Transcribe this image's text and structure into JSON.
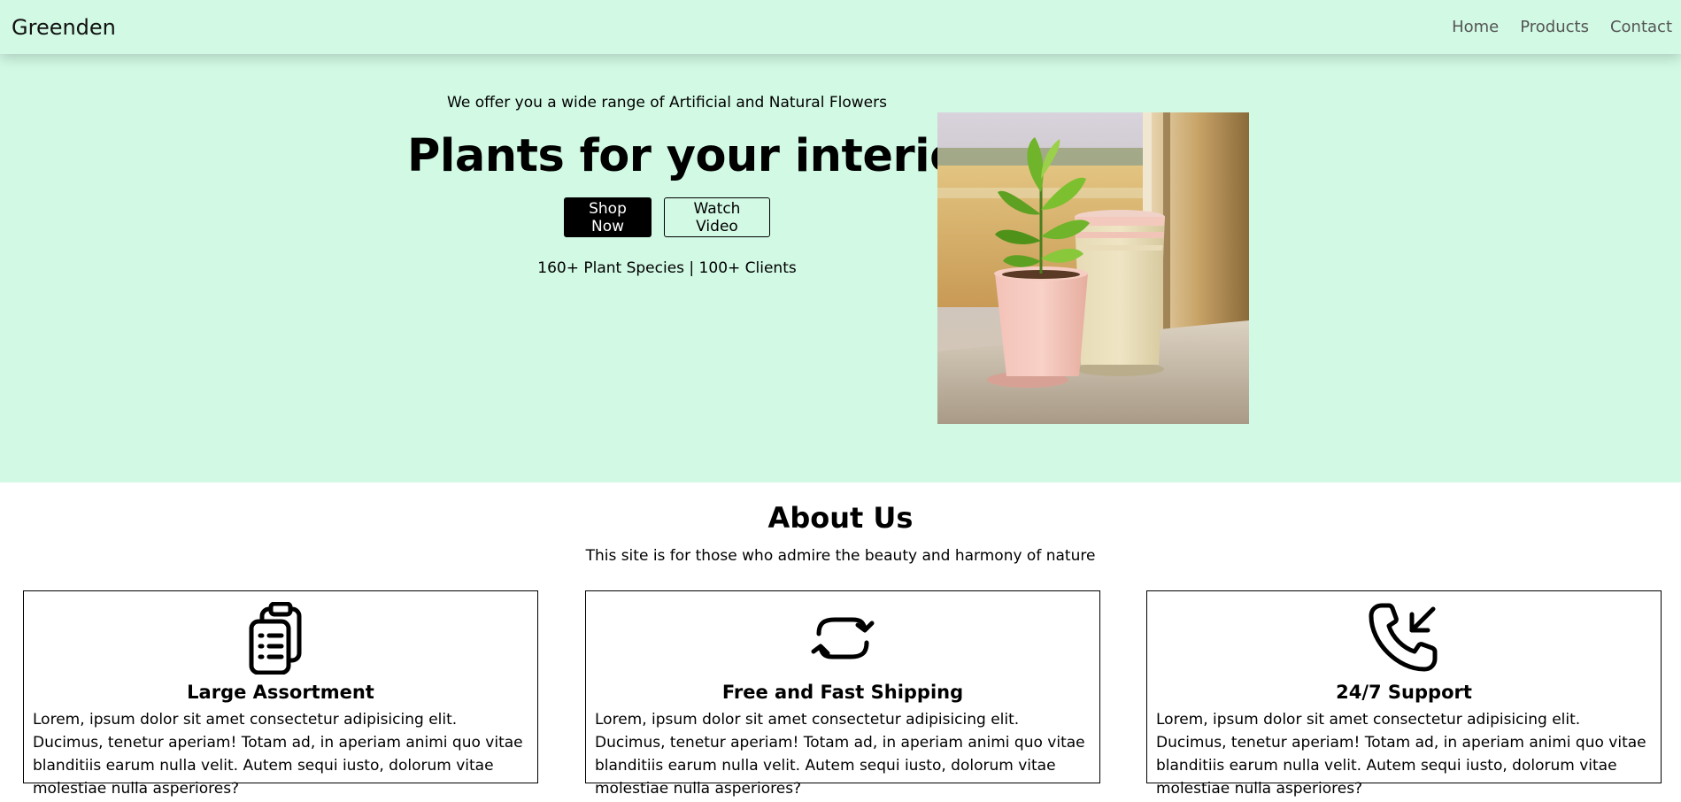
{
  "nav": {
    "brand": "Greenden",
    "links": [
      "Home",
      "Products",
      "Contact"
    ]
  },
  "hero": {
    "tagline": "We offer you a wide range of Artificial and Natural Flowers",
    "headline": "Plants for your interior",
    "primary_button": "Shop Now",
    "secondary_button": "Watch Video",
    "stats": "160+ Plant Species | 100+ Clients"
  },
  "about": {
    "title": "About Us",
    "subtitle": "This site is for those who admire the beauty and harmony of nature",
    "cards": [
      {
        "icon": "clipboard-list-icon",
        "title": "Large Assortment",
        "text": "Lorem, ipsum dolor sit amet consectetur adipisicing elit. Ducimus, tenetur aperiam! Totam ad, in aperiam animi quo vitae blanditiis earum nulla velit. Autem sequi iusto, dolorum vitae molestiae nulla asperiores?"
      },
      {
        "icon": "repeat-arrows-icon",
        "title": "Free and Fast Shipping",
        "text": "Lorem, ipsum dolor sit amet consectetur adipisicing elit. Ducimus, tenetur aperiam! Totam ad, in aperiam animi quo vitae blanditiis earum nulla velit. Autem sequi iusto, dolorum vitae molestiae nulla asperiores?"
      },
      {
        "icon": "phone-incoming-icon",
        "title": "24/7 Support",
        "text": "Lorem, ipsum dolor sit amet consectetur adipisicing elit. Ducimus, tenetur aperiam! Totam ad, in aperiam animi quo vitae blanditiis earum nulla velit. Autem sequi iusto, dolorum vitae molestiae nulla asperiores?"
      }
    ]
  },
  "colors": {
    "hero_background": "#d1f9e4",
    "primary_button": "#000000",
    "nav_link": "#555555"
  }
}
